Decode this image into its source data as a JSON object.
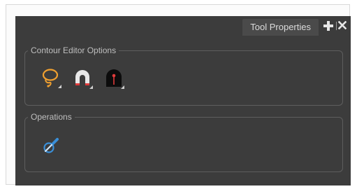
{
  "window": {
    "tab_title": "Tool Properties"
  },
  "contour_group": {
    "title": "Contour Editor Options",
    "tools": [
      {
        "icon": "lasso-select-icon"
      },
      {
        "icon": "magnet-icon"
      },
      {
        "icon": "contour-shape-icon"
      }
    ]
  },
  "operations_group": {
    "title": "Operations",
    "tools": [
      {
        "icon": "pipette-icon"
      }
    ]
  },
  "colors": {
    "panel_bg": "#3c3c3c",
    "accent_orange": "#f0a030",
    "accent_blue": "#3a8fd8",
    "accent_red": "#e03b3b"
  }
}
